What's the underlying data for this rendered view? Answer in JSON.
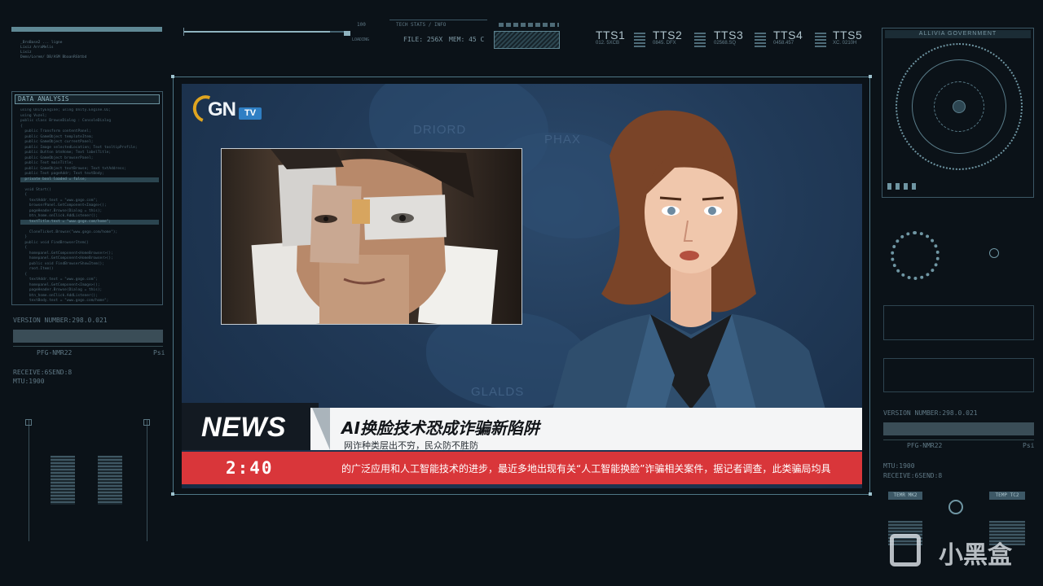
{
  "hud": {
    "top_left_code": [
      "_BroBase2 ... ligne",
      "Lixiz ArraMelis",
      "Lixiz",
      "Demo/Lorem/ DB/ASM BbaanRGbtbd"
    ],
    "load_value": "100",
    "load_label": "LOADING",
    "load_progress": 0.88,
    "tech_stats_label": "TECH STATS / INFO",
    "file_size": "FILE: 256X",
    "mem": "MEM: 45 C",
    "tts": [
      {
        "name": "TTS1",
        "sub": "012. 5XCB"
      },
      {
        "name": "TTS2",
        "sub": "0845. DFX"
      },
      {
        "name": "TTS3",
        "sub": "02568.SQ"
      },
      {
        "name": "TTS4",
        "sub": "0458.457"
      },
      {
        "name": "TTS5",
        "sub": "XC. 0210H"
      }
    ]
  },
  "left_panel": {
    "title": "DATA ANALYSIS",
    "version": "VERSION NUMBER:298.0.021",
    "pfg": "PFG-NMR22",
    "psi": "Psi",
    "receive": "RECEIVE:6SEND:8",
    "mtu": "MTU:1900"
  },
  "right_panel": {
    "title": "ALLIVIA GOVERNMENT",
    "version": "VERSION NUMBER:298.0.021",
    "pfg": "PFG-NMR22",
    "psi": "Psi",
    "mtu": "MTU:1900",
    "receive": "RECEIVE:6SEND:8",
    "temp1": "TEMR MK2",
    "temp2": "TEMP TC2"
  },
  "broadcast": {
    "logo_gn": "GN",
    "logo_tv": "TV",
    "map_labels": [
      "DRIORD",
      "PHAX",
      "GLALDS"
    ],
    "news_label": "NEWS",
    "headline": "AI换脸技术恐成诈骗新陷阱",
    "subline": "网诈种类层出不穷，民众防不胜防",
    "time": "2:40",
    "ticker": "的广泛应用和人工智能技术的进步，最近多地出现有关“人工智能换脸”诈骗相关案件，据记者调查，此类骗局均具"
  },
  "watermark": {
    "text": "小黑盒"
  },
  "colors": {
    "accent_red": "#d9363a",
    "hud_cyan": "#6f96a3",
    "screen_blue": "#213a58",
    "logo_gold": "#e0a520",
    "logo_blue": "#2f7fc4"
  }
}
